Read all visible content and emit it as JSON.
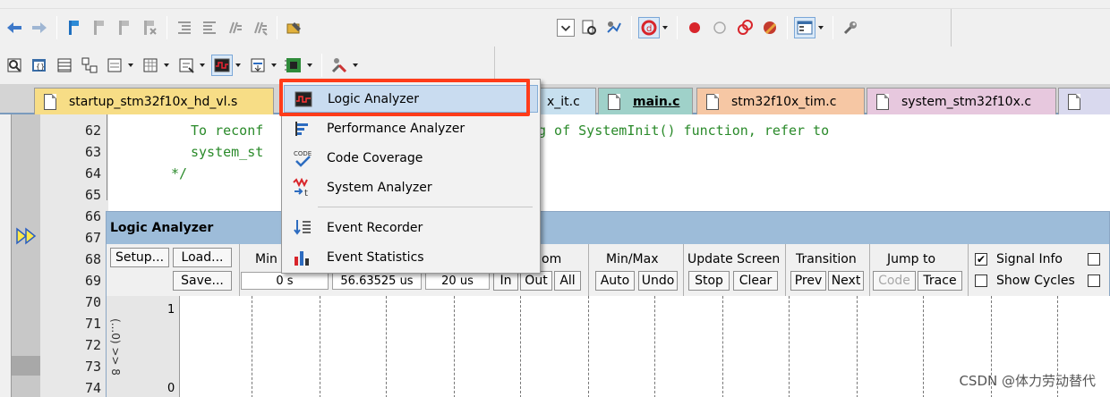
{
  "toolbar1": {
    "icons": [
      "back-arrow-icon",
      "forward-arrow-icon",
      "bookmark-icon",
      "bookmark-prev-icon",
      "bookmark-next-icon",
      "bookmark-clear-icon",
      "indent-icon",
      "unindent-icon",
      "comment-icon",
      "uncomment-icon",
      "find-in-files-icon",
      "select-icon",
      "find-icon",
      "browse-icon",
      "debug-icon",
      "breakpoint-icon",
      "breakpoint-disable-icon",
      "kill-breakpoints-icon",
      "clear-breakpoints-icon",
      "window-layout-icon",
      "wrench-icon"
    ]
  },
  "toolbar2": {
    "icons": [
      "disassembly-icon",
      "symbols-icon",
      "registers-icon",
      "call-stack-icon",
      "watch-icon",
      "memory-icon",
      "serial-icon",
      "analysis-icon",
      "trace-icon",
      "system-viewer-icon",
      "toolbox-icon"
    ]
  },
  "tabs": {
    "startup": "startup_stm32f10x_hd_vl.s",
    "it": "x_it.c",
    "main": "main.c",
    "tim": "stm32f10x_tim.c",
    "system": "system_stm32f10x.c"
  },
  "editor": {
    "line_numbers": [
      "62",
      "63",
      "64",
      "65",
      "66",
      "67",
      "68",
      "69",
      "70",
      "71",
      "72",
      "73",
      "74"
    ],
    "code": {
      "l62a": "To reconf",
      "l62b": "g of SystemInit() function, refer to",
      "l63": "system_st",
      "l64": "*/"
    }
  },
  "menu": {
    "items": [
      {
        "label": "Logic Analyzer"
      },
      {
        "label": "Performance Analyzer"
      },
      {
        "label": "Code Coverage"
      },
      {
        "label": "System Analyzer"
      },
      {
        "label": "Event Recorder"
      },
      {
        "label": "Event Statistics"
      }
    ]
  },
  "logic_analyzer": {
    "title": "Logic Analyzer",
    "setup": "Setup...",
    "load": "Load...",
    "save": "Save...",
    "min_label": "Min T",
    "min_value": "0 s",
    "max_value": "56.63525 us",
    "range_value": "20 us",
    "zoom_label": "om",
    "zoom_in": "In",
    "zoom_out": "Out",
    "zoom_all": "All",
    "minmax_label": "Min/Max",
    "auto": "Auto",
    "undo": "Undo",
    "update_label": "Update Screen",
    "stop": "Stop",
    "clear": "Clear",
    "transition_label": "Transition",
    "prev": "Prev",
    "next": "Next",
    "jump_label": "Jump to",
    "code": "Code",
    "trace": "Trace",
    "signal_info": "Signal Info",
    "show_cycles": "Show Cycles",
    "signal_checked": "✔",
    "sig_hi": "1",
    "sig_lo": "0",
    "sig_name": "(...0) >> 8"
  },
  "watermark": "CSDN @体力劳动替代"
}
